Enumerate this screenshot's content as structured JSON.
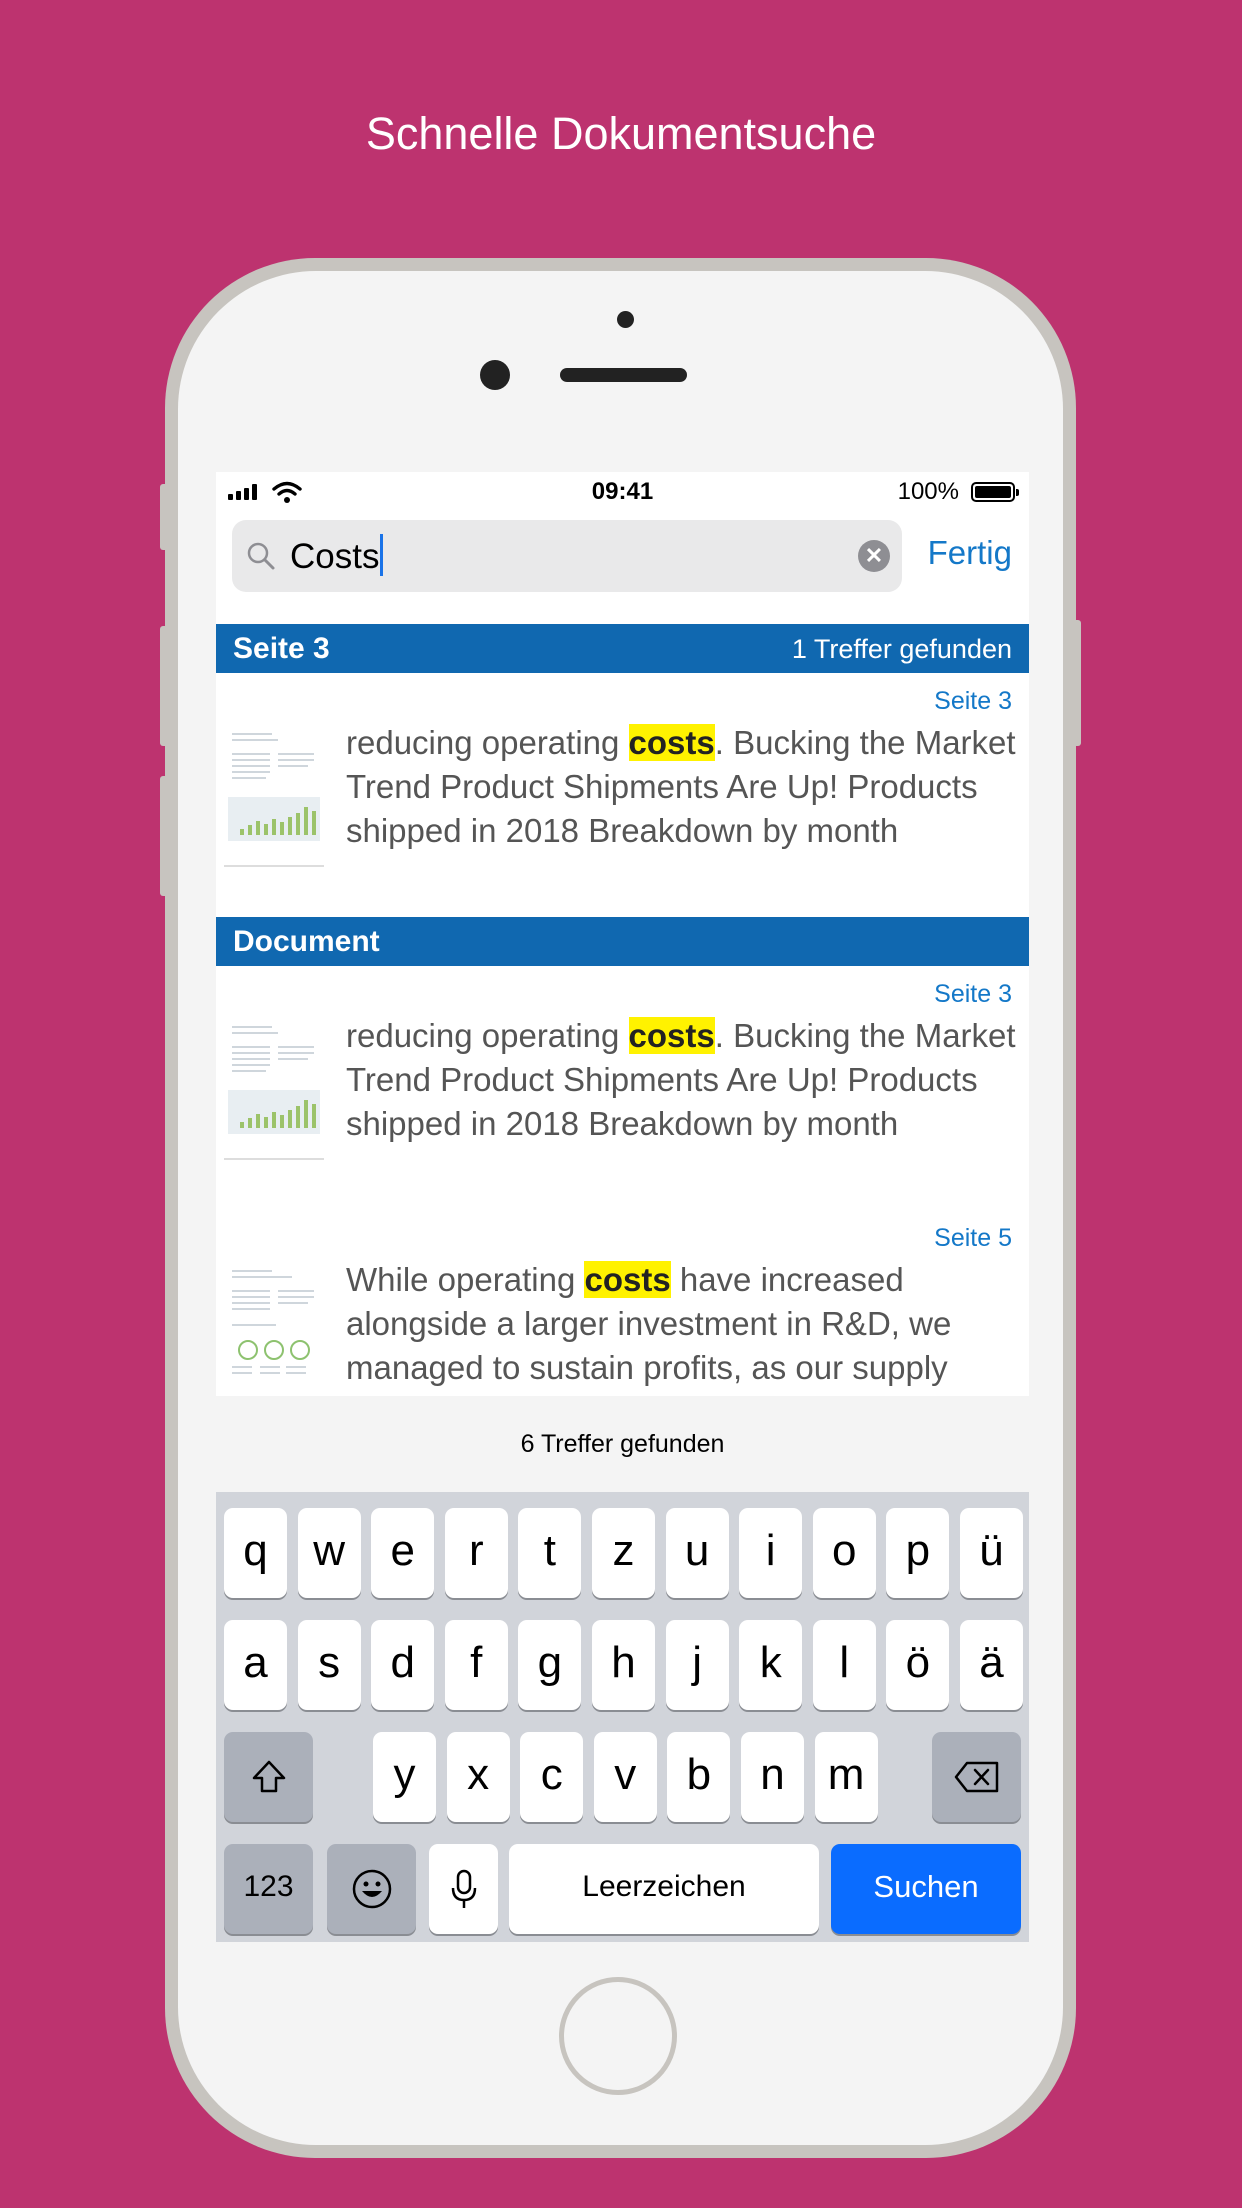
{
  "headline": "Schnelle Dokumentsuche",
  "status_bar": {
    "time": "09:41",
    "battery": "100%"
  },
  "search": {
    "query": "Costs",
    "done_label": "Fertig"
  },
  "sections": [
    {
      "title": "Seite 3",
      "count": "1 Treffer gefunden"
    },
    {
      "title": "Document"
    }
  ],
  "results": [
    {
      "page": "Seite 3",
      "before": "reducing operating ",
      "match": "costs",
      "after": ". Bucking the Market Trend Product Shipments Are Up! Products shipped in 2018 Breakdown by month"
    },
    {
      "page": "Seite 3",
      "before": "reducing operating ",
      "match": "costs",
      "after": ". Bucking the Market Trend Product Shipments Are Up! Products shipped in 2018 Breakdown by month"
    },
    {
      "page": "Seite 5",
      "before": "While operating ",
      "match": "costs",
      "after": " have increased alongside a larger investment in R&D, we managed to sustain profits, as our supply"
    }
  ],
  "total_hits": "6 Treffer gefunden",
  "keyboard": {
    "row1": [
      "q",
      "w",
      "e",
      "r",
      "t",
      "z",
      "u",
      "i",
      "o",
      "p",
      "ü"
    ],
    "row2": [
      "a",
      "s",
      "d",
      "f",
      "g",
      "h",
      "j",
      "k",
      "l",
      "ö",
      "ä"
    ],
    "row3": [
      "y",
      "x",
      "c",
      "v",
      "b",
      "n",
      "m"
    ],
    "numbers_label": "123",
    "space_label": "Leerzeichen",
    "return_label": "Suchen"
  }
}
